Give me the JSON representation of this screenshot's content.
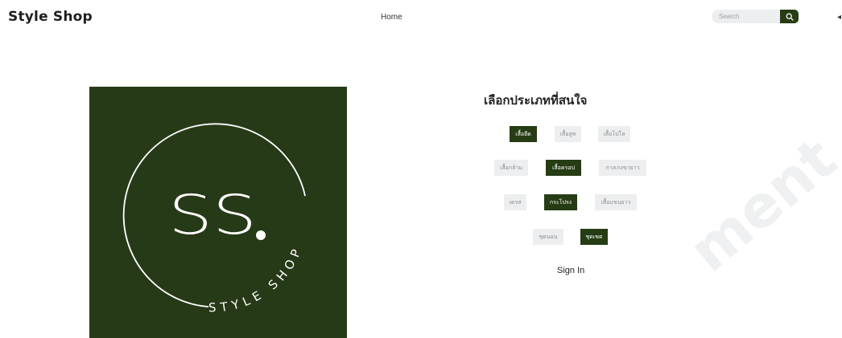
{
  "header": {
    "brand": "Style Shop",
    "nav_home": "Home",
    "search_placeholder": "Search",
    "cart_symbol": "◂"
  },
  "logo": {
    "monogram": "SS",
    "dot": ".",
    "tagline": "STYLE SHOP"
  },
  "category": {
    "title": "เลือกประเภทที่สนใจ",
    "chips": [
      {
        "label": "เสื้อยืด",
        "active": true
      },
      {
        "label": "เสื้อสูท",
        "active": false
      },
      {
        "label": "เสื้อโปโล",
        "active": false
      },
      {
        "label": "เสื้อกล้าม",
        "active": false
      },
      {
        "label": "เสื้อครอป",
        "active": true
      },
      {
        "label": "กางเกงขายาว",
        "active": false
      },
      {
        "label": "เดรส",
        "active": false
      },
      {
        "label": "กระโปรง",
        "active": true
      },
      {
        "label": "เสื้อแขนยาว",
        "active": false
      },
      {
        "label": "ชุดนอน",
        "active": false
      },
      {
        "label": "ชุดเซต",
        "active": true
      }
    ]
  },
  "auth": {
    "sign_in": "Sign In"
  },
  "watermark": "ment",
  "colors": {
    "accent": "#263c14",
    "chip_bg": "#eceeef",
    "logo_bg": "#273a17"
  }
}
